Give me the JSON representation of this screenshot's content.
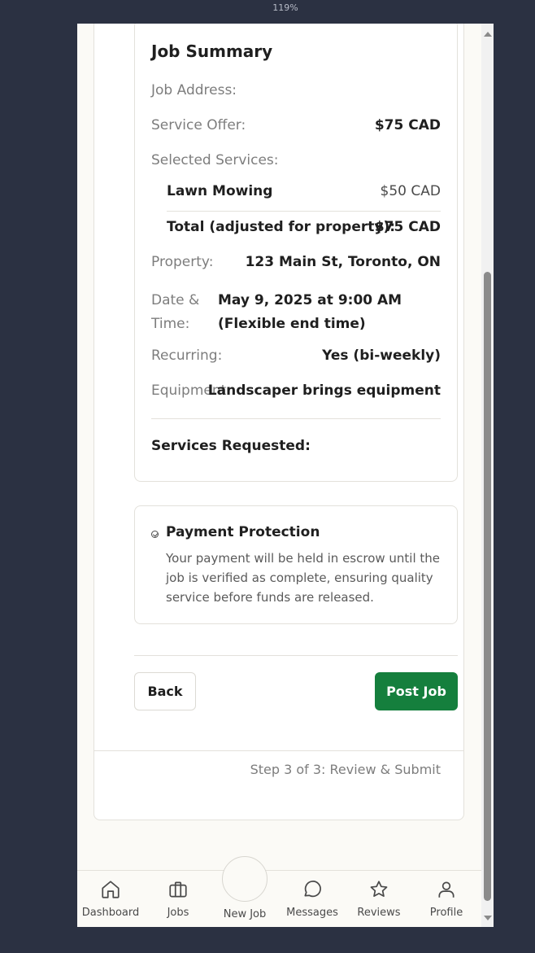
{
  "zoom": "119%",
  "summary": {
    "title": "Job Summary",
    "job_address_label": "Job Address:",
    "service_offer_label": "Service Offer:",
    "service_offer_value": "$75 CAD",
    "selected_services_label": "Selected Services:",
    "service_item_name": "Lawn Mowing",
    "service_item_price": "$50 CAD",
    "total_label": "Total (adjusted for property):",
    "total_value": "$75 CAD",
    "property_label": "Property:",
    "property_value": "123 Main St, Toronto, ON",
    "datetime_label_1": "Date &",
    "datetime_label_2": "Time:",
    "datetime_value_1": "May 9, 2025 at 9:00 AM",
    "datetime_value_2": "(Flexible end time)",
    "recurring_label": "Recurring:",
    "recurring_value": "Yes (bi-weekly)",
    "equipment_label": "Equipment:",
    "equipment_value": "Landscaper brings equipment",
    "services_requested_label": "Services Requested:"
  },
  "protection": {
    "title": "Payment Protection",
    "text": "Your payment will be held in escrow until the job is verified as complete, ensuring quality service before funds are released."
  },
  "actions": {
    "back_label": "Back",
    "post_label": "Post Job"
  },
  "footer": {
    "step_text": "Step 3 of 3: Review & Submit"
  },
  "nav": {
    "dashboard": "Dashboard",
    "jobs": "Jobs",
    "new_job": "New Job",
    "messages": "Messages",
    "reviews": "Reviews",
    "profile": "Profile"
  },
  "colors": {
    "primary": "#157f3d",
    "background": "#2b3142"
  }
}
